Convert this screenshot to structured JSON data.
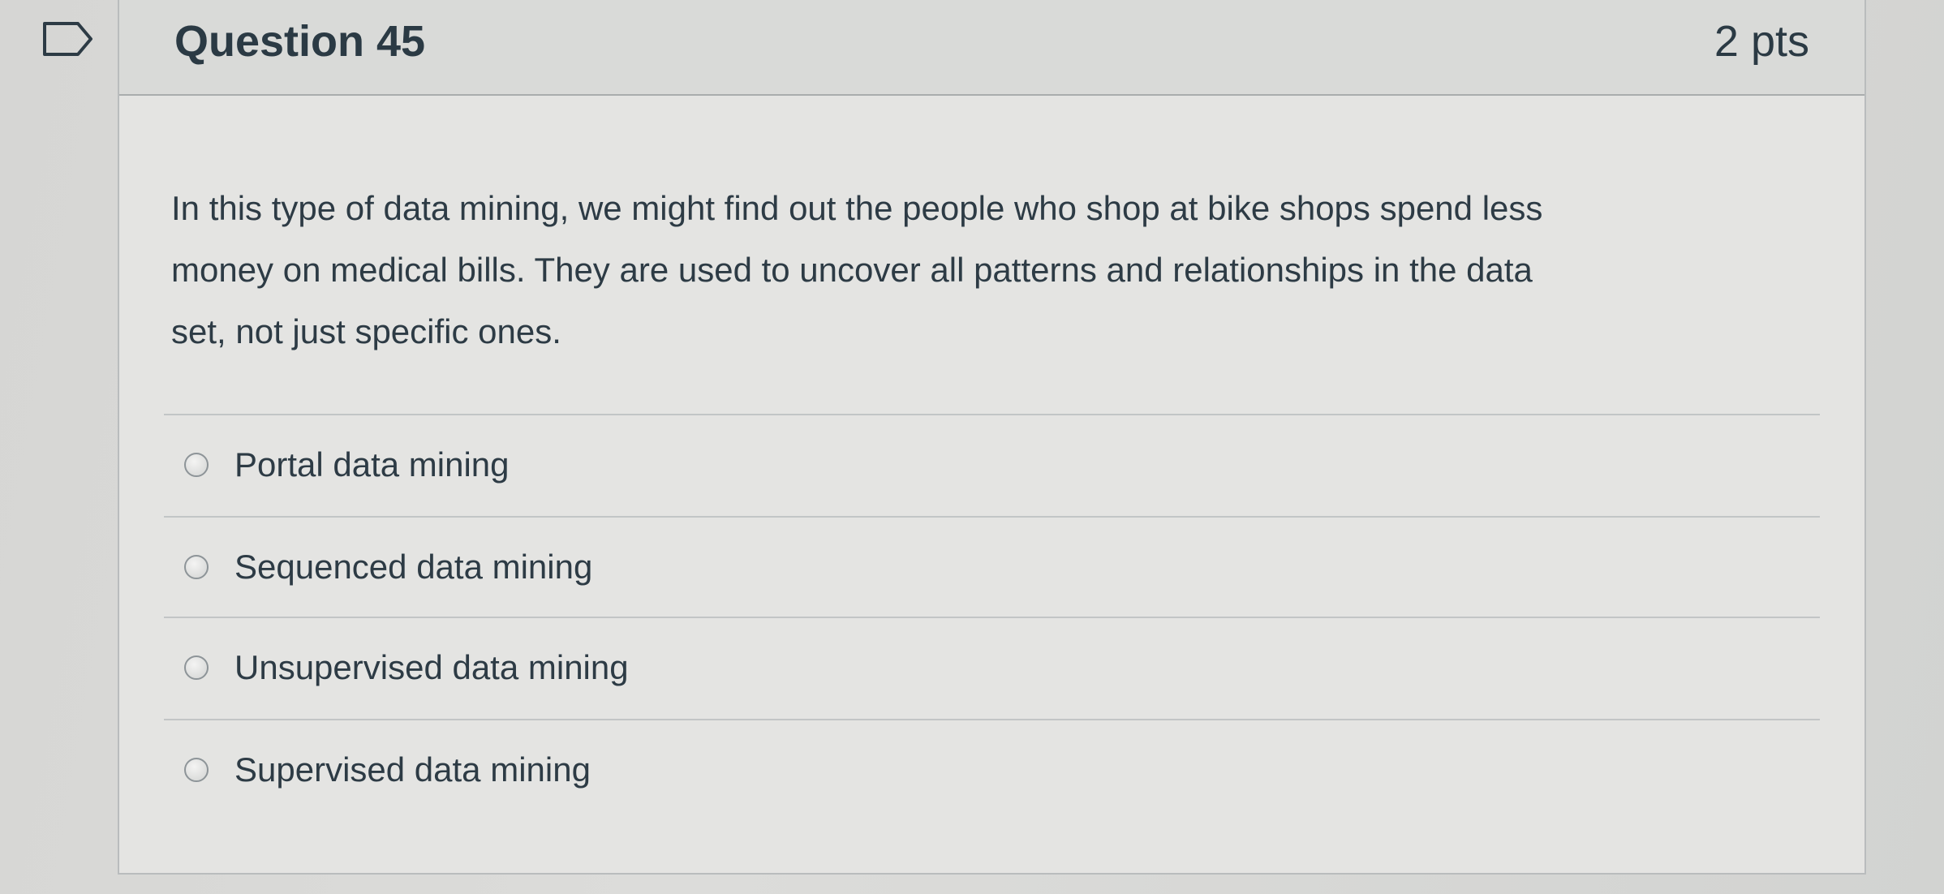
{
  "question": {
    "title": "Question 45",
    "points": "2 pts",
    "text_lines": [
      "In this type of data mining, we might find out the people who shop at bike shops spend less",
      "money on medical bills. They are used to uncover all patterns and relationships in the data",
      "set, not just specific ones."
    ],
    "flag_icon": "bookmark-flag-icon"
  },
  "answers": [
    {
      "label": "Portal data mining",
      "selected": false
    },
    {
      "label": "Sequenced data mining",
      "selected": false
    },
    {
      "label": "Unsupervised data mining",
      "selected": false
    },
    {
      "label": "Supervised data mining",
      "selected": false
    }
  ]
}
